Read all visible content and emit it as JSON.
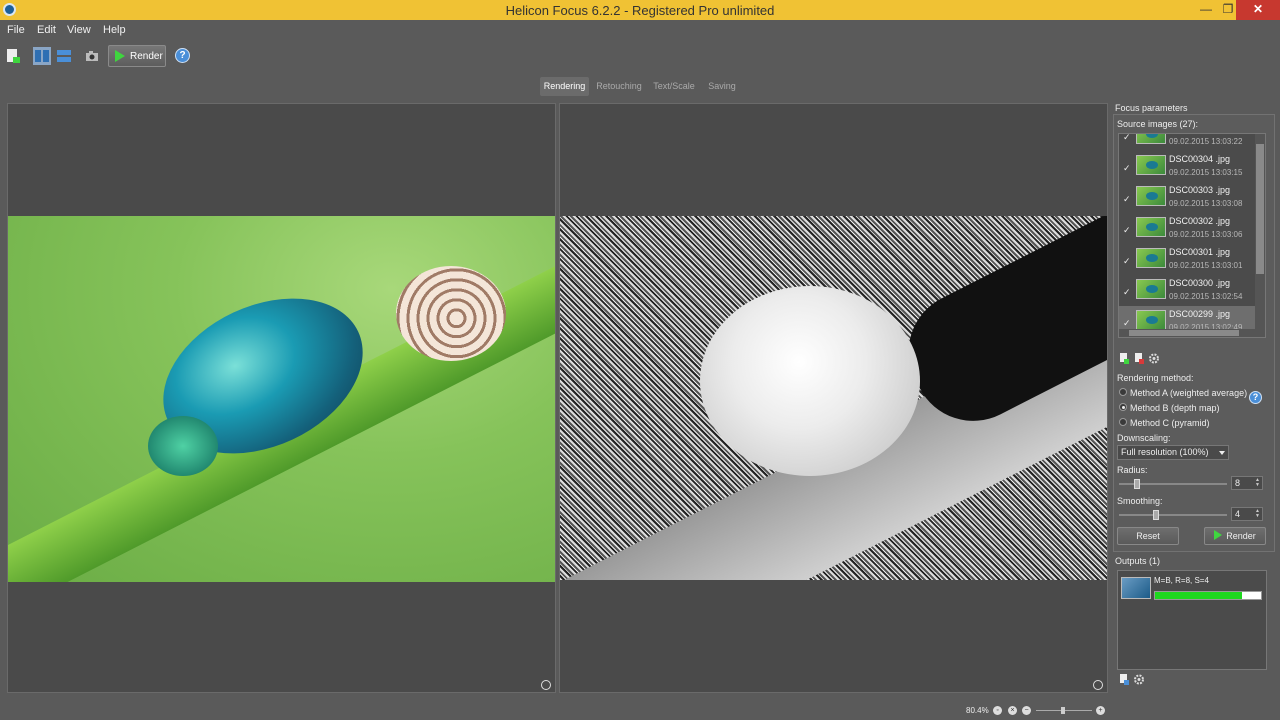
{
  "window": {
    "title": "Helicon Focus 6.2.2 - Registered Pro unlimited",
    "minimize": "—",
    "maximize": "❐",
    "close": "✕"
  },
  "menu": {
    "file": "File",
    "edit": "Edit",
    "view": "View",
    "help": "Help"
  },
  "toolbar": {
    "render_label": "Render",
    "help_icon": "?"
  },
  "tabs": [
    "Rendering",
    "Retouching",
    "Text/Scale",
    "Saving"
  ],
  "panel": {
    "focus_parameters": "Focus parameters",
    "source_images_label": "Source images (27):",
    "source_images": [
      {
        "name": "",
        "date": "09.02.2015 13:03:22"
      },
      {
        "name": "DSC00304 .jpg",
        "date": "09.02.2015 13:03:15"
      },
      {
        "name": "DSC00303 .jpg",
        "date": "09.02.2015 13:03:08"
      },
      {
        "name": "DSC00302 .jpg",
        "date": "09.02.2015 13:03:06"
      },
      {
        "name": "DSC00301 .jpg",
        "date": "09.02.2015 13:03:01"
      },
      {
        "name": "DSC00300 .jpg",
        "date": "09.02.2015 13:02:54"
      },
      {
        "name": "DSC00299 .jpg",
        "date": "09.02.2015 13:02:49"
      }
    ],
    "rendering_method_label": "Rendering method:",
    "method_a": "Method A (weighted average)",
    "method_b": "Method B (depth map)",
    "method_c": "Method C (pyramid)",
    "selected_method": "Method B (depth map)",
    "downscaling_label": "Downscaling:",
    "downscaling_value": "Full resolution (100%)",
    "radius_label": "Radius:",
    "radius_value": "8",
    "smoothing_label": "Smoothing:",
    "smoothing_value": "4",
    "reset_label": "Reset",
    "render_label": "Render",
    "outputs_label": "Outputs (1)",
    "output_item": {
      "text": "M=B, R=8, S=4",
      "progress": 0.82
    }
  },
  "status": {
    "zoom": "80.4%"
  },
  "colors": {
    "titlebar": "#f0c234",
    "accent_green": "#3fd63f",
    "close": "#c7382f"
  }
}
